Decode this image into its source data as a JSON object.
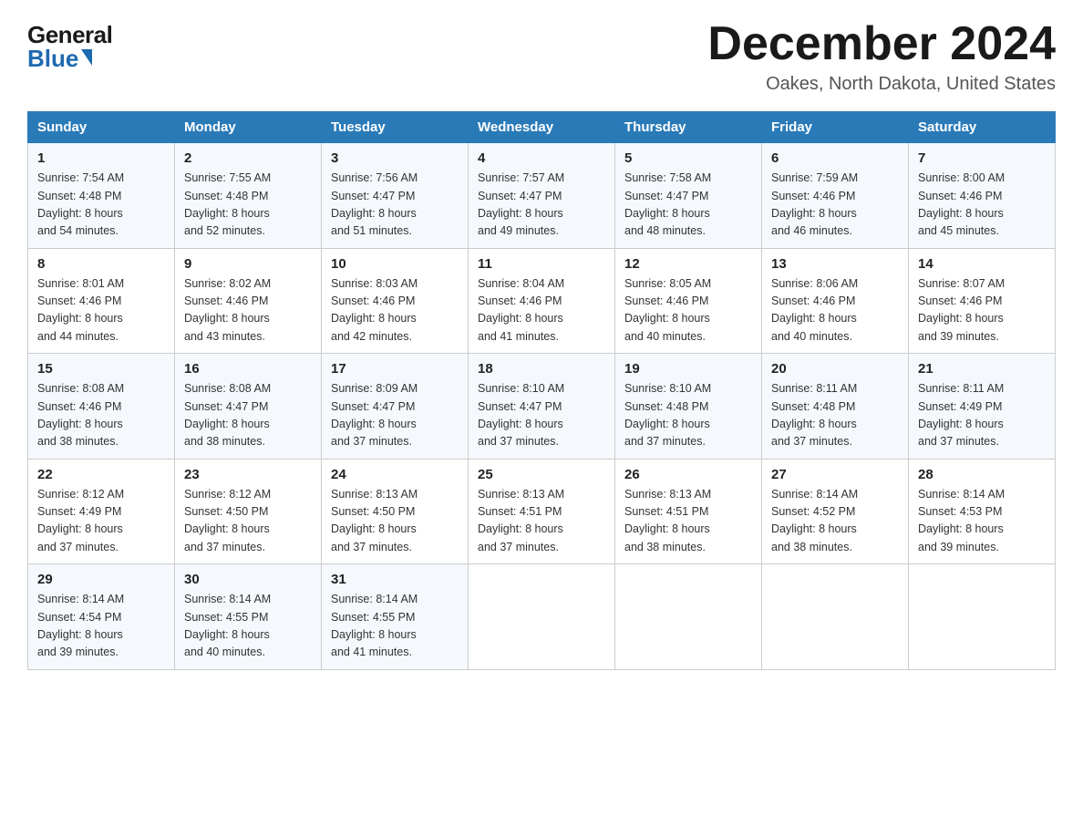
{
  "logo": {
    "general": "General",
    "blue": "Blue"
  },
  "title": "December 2024",
  "location": "Oakes, North Dakota, United States",
  "days_of_week": [
    "Sunday",
    "Monday",
    "Tuesday",
    "Wednesday",
    "Thursday",
    "Friday",
    "Saturday"
  ],
  "weeks": [
    [
      {
        "day": "1",
        "sunrise": "7:54 AM",
        "sunset": "4:48 PM",
        "daylight": "8 hours and 54 minutes."
      },
      {
        "day": "2",
        "sunrise": "7:55 AM",
        "sunset": "4:48 PM",
        "daylight": "8 hours and 52 minutes."
      },
      {
        "day": "3",
        "sunrise": "7:56 AM",
        "sunset": "4:47 PM",
        "daylight": "8 hours and 51 minutes."
      },
      {
        "day": "4",
        "sunrise": "7:57 AM",
        "sunset": "4:47 PM",
        "daylight": "8 hours and 49 minutes."
      },
      {
        "day": "5",
        "sunrise": "7:58 AM",
        "sunset": "4:47 PM",
        "daylight": "8 hours and 48 minutes."
      },
      {
        "day": "6",
        "sunrise": "7:59 AM",
        "sunset": "4:46 PM",
        "daylight": "8 hours and 46 minutes."
      },
      {
        "day": "7",
        "sunrise": "8:00 AM",
        "sunset": "4:46 PM",
        "daylight": "8 hours and 45 minutes."
      }
    ],
    [
      {
        "day": "8",
        "sunrise": "8:01 AM",
        "sunset": "4:46 PM",
        "daylight": "8 hours and 44 minutes."
      },
      {
        "day": "9",
        "sunrise": "8:02 AM",
        "sunset": "4:46 PM",
        "daylight": "8 hours and 43 minutes."
      },
      {
        "day": "10",
        "sunrise": "8:03 AM",
        "sunset": "4:46 PM",
        "daylight": "8 hours and 42 minutes."
      },
      {
        "day": "11",
        "sunrise": "8:04 AM",
        "sunset": "4:46 PM",
        "daylight": "8 hours and 41 minutes."
      },
      {
        "day": "12",
        "sunrise": "8:05 AM",
        "sunset": "4:46 PM",
        "daylight": "8 hours and 40 minutes."
      },
      {
        "day": "13",
        "sunrise": "8:06 AM",
        "sunset": "4:46 PM",
        "daylight": "8 hours and 40 minutes."
      },
      {
        "day": "14",
        "sunrise": "8:07 AM",
        "sunset": "4:46 PM",
        "daylight": "8 hours and 39 minutes."
      }
    ],
    [
      {
        "day": "15",
        "sunrise": "8:08 AM",
        "sunset": "4:46 PM",
        "daylight": "8 hours and 38 minutes."
      },
      {
        "day": "16",
        "sunrise": "8:08 AM",
        "sunset": "4:47 PM",
        "daylight": "8 hours and 38 minutes."
      },
      {
        "day": "17",
        "sunrise": "8:09 AM",
        "sunset": "4:47 PM",
        "daylight": "8 hours and 37 minutes."
      },
      {
        "day": "18",
        "sunrise": "8:10 AM",
        "sunset": "4:47 PM",
        "daylight": "8 hours and 37 minutes."
      },
      {
        "day": "19",
        "sunrise": "8:10 AM",
        "sunset": "4:48 PM",
        "daylight": "8 hours and 37 minutes."
      },
      {
        "day": "20",
        "sunrise": "8:11 AM",
        "sunset": "4:48 PM",
        "daylight": "8 hours and 37 minutes."
      },
      {
        "day": "21",
        "sunrise": "8:11 AM",
        "sunset": "4:49 PM",
        "daylight": "8 hours and 37 minutes."
      }
    ],
    [
      {
        "day": "22",
        "sunrise": "8:12 AM",
        "sunset": "4:49 PM",
        "daylight": "8 hours and 37 minutes."
      },
      {
        "day": "23",
        "sunrise": "8:12 AM",
        "sunset": "4:50 PM",
        "daylight": "8 hours and 37 minutes."
      },
      {
        "day": "24",
        "sunrise": "8:13 AM",
        "sunset": "4:50 PM",
        "daylight": "8 hours and 37 minutes."
      },
      {
        "day": "25",
        "sunrise": "8:13 AM",
        "sunset": "4:51 PM",
        "daylight": "8 hours and 37 minutes."
      },
      {
        "day": "26",
        "sunrise": "8:13 AM",
        "sunset": "4:51 PM",
        "daylight": "8 hours and 38 minutes."
      },
      {
        "day": "27",
        "sunrise": "8:14 AM",
        "sunset": "4:52 PM",
        "daylight": "8 hours and 38 minutes."
      },
      {
        "day": "28",
        "sunrise": "8:14 AM",
        "sunset": "4:53 PM",
        "daylight": "8 hours and 39 minutes."
      }
    ],
    [
      {
        "day": "29",
        "sunrise": "8:14 AM",
        "sunset": "4:54 PM",
        "daylight": "8 hours and 39 minutes."
      },
      {
        "day": "30",
        "sunrise": "8:14 AM",
        "sunset": "4:55 PM",
        "daylight": "8 hours and 40 minutes."
      },
      {
        "day": "31",
        "sunrise": "8:14 AM",
        "sunset": "4:55 PM",
        "daylight": "8 hours and 41 minutes."
      },
      null,
      null,
      null,
      null
    ]
  ],
  "labels": {
    "sunrise": "Sunrise:",
    "sunset": "Sunset:",
    "daylight": "Daylight:"
  }
}
